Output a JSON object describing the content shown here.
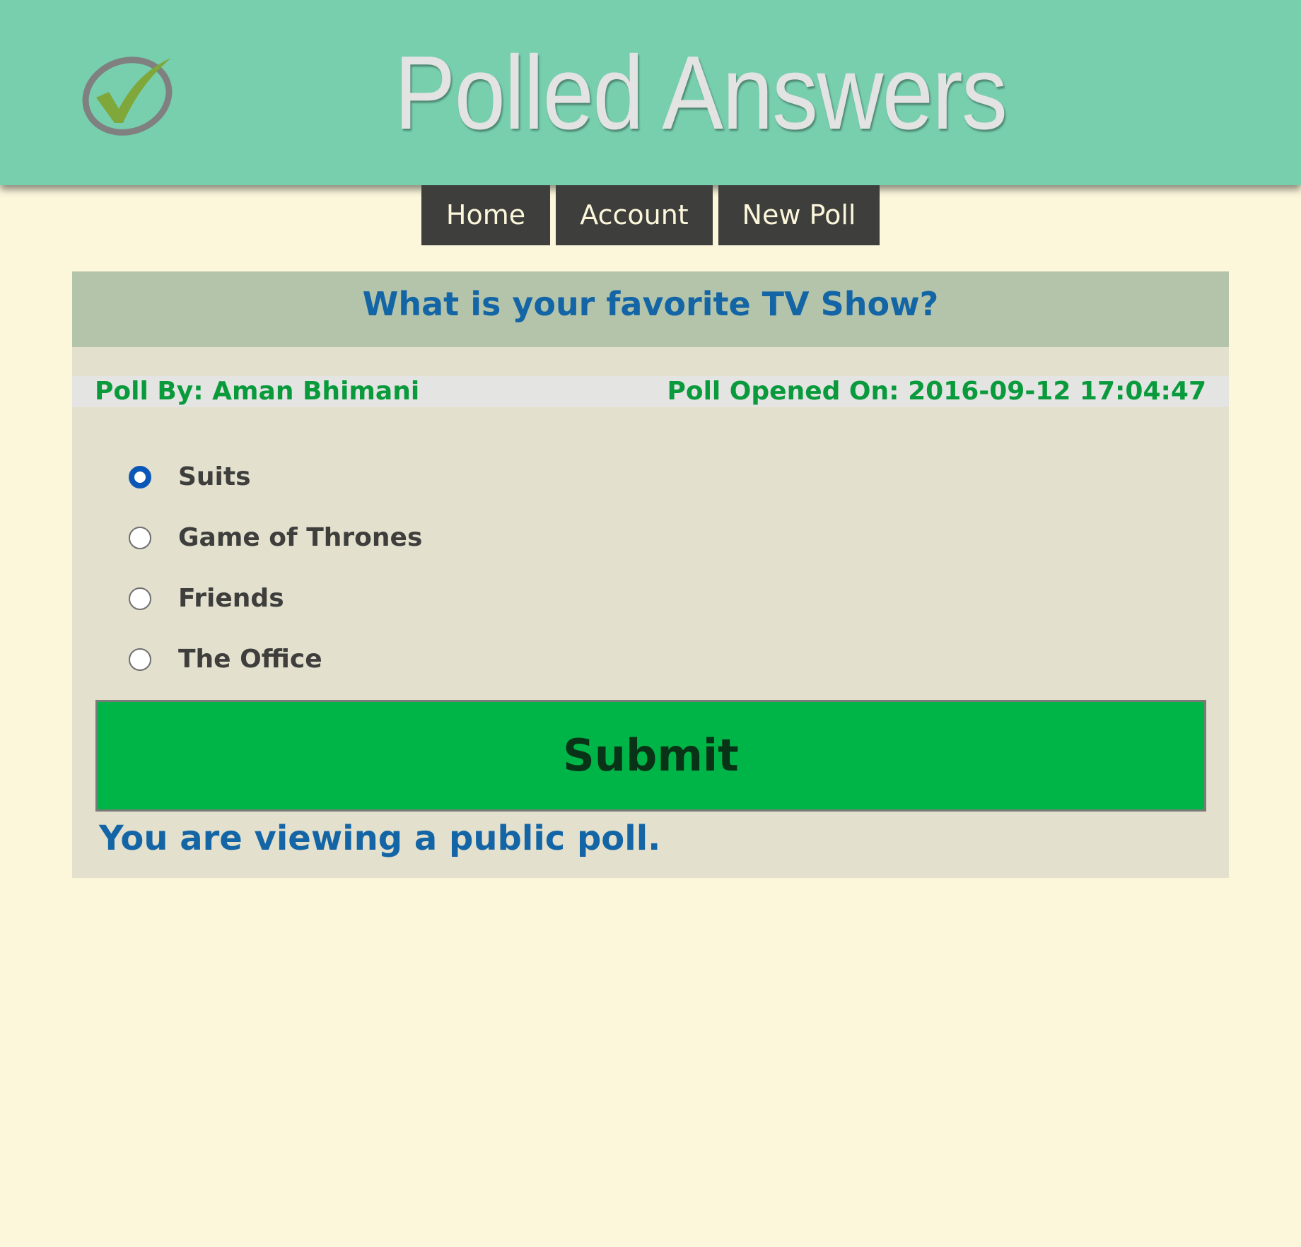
{
  "header": {
    "title": "Polled Answers",
    "logo_icon": "checkmark-circle-icon",
    "background_color": "#77cfae"
  },
  "nav": {
    "items": [
      {
        "label": "Home"
      },
      {
        "label": "Account"
      },
      {
        "label": "New Poll"
      }
    ]
  },
  "poll": {
    "question": "What is your favorite TV Show?",
    "poll_by": "Poll By: Aman Bhimani",
    "opened_on": "Poll Opened On: 2016-09-12 17:04:47",
    "options": [
      {
        "label": "Suits",
        "selected": true
      },
      {
        "label": "Game of Thrones",
        "selected": false
      },
      {
        "label": "Friends",
        "selected": false
      },
      {
        "label": "The Office",
        "selected": false
      }
    ],
    "submit_label": "Submit",
    "public_note": "You are viewing a public poll."
  },
  "colors": {
    "page_background": "#fcf7db",
    "question_color": "#1365a5",
    "meta_color": "#099a3c",
    "submit_background": "#00b548",
    "nav_background": "#3e3e3c"
  }
}
